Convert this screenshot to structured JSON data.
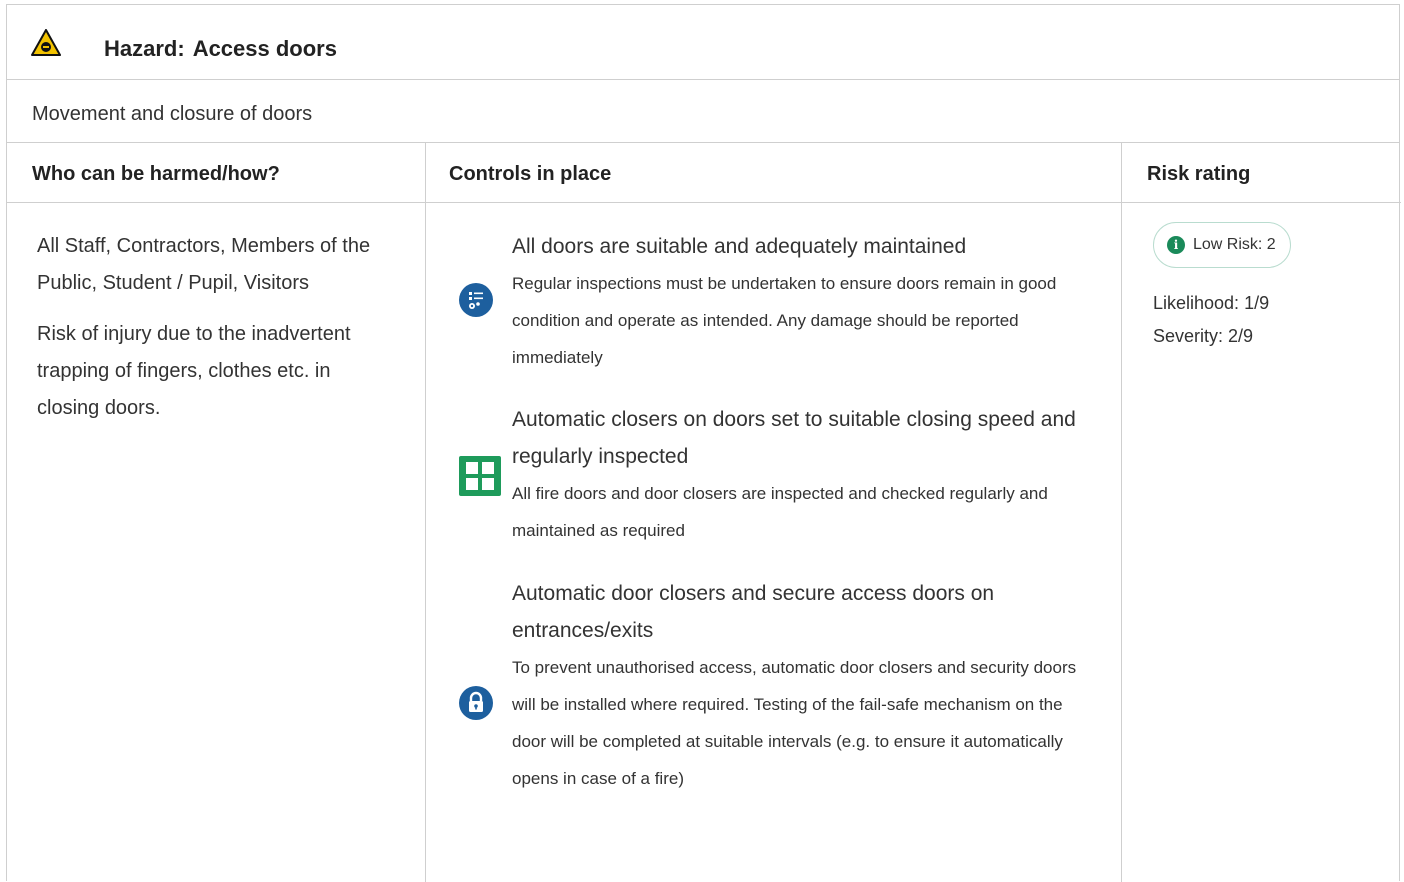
{
  "hazard": {
    "label": "Hazard:",
    "name": "Access doors",
    "icon": "door-trap-warning-icon",
    "description": "Movement and closure of doors"
  },
  "columns": {
    "who": "Who can be harmed/how?",
    "controls": "Controls in place",
    "risk": "Risk rating"
  },
  "who": {
    "groups": "All Staff, Contractors, Members of the Public, Student / Pupil, Visitors",
    "risk": "Risk of injury due to the inadvertent trapping of fingers, clothes etc. in closing doors."
  },
  "controls": [
    {
      "icon": "inspection-checklist-icon",
      "title": "All doors are suitable and adequately maintained",
      "description": "Regular inspections must be undertaken to ensure doors remain in good condition and operate as intended. Any damage should be reported immediately"
    },
    {
      "icon": "door-closer-icon",
      "title": "Automatic closers on doors set to suitable closing speed and regularly inspected",
      "description": "All fire doors and door closers are inspected and checked regularly and maintained as required"
    },
    {
      "icon": "padlock-icon",
      "title": "Automatic door closers and secure access doors on entrances/exits",
      "description": "To prevent unauthorised access, automatic door closers and security doors will be installed where required. Testing of the fail-safe mechanism on the door will be completed at suitable intervals (e.g. to ensure it automatically opens in case of a fire)"
    }
  ],
  "risk": {
    "badge": "Low Risk: 2",
    "likelihood": "Likelihood: 1/9",
    "severity": "Severity: 2/9"
  },
  "colors": {
    "border": "#cfcfcf",
    "warning_yellow": "#f2c200",
    "icon_blue": "#1d5f9e",
    "icon_green": "#1e9b5b",
    "badge_green": "#1a8a5a"
  }
}
